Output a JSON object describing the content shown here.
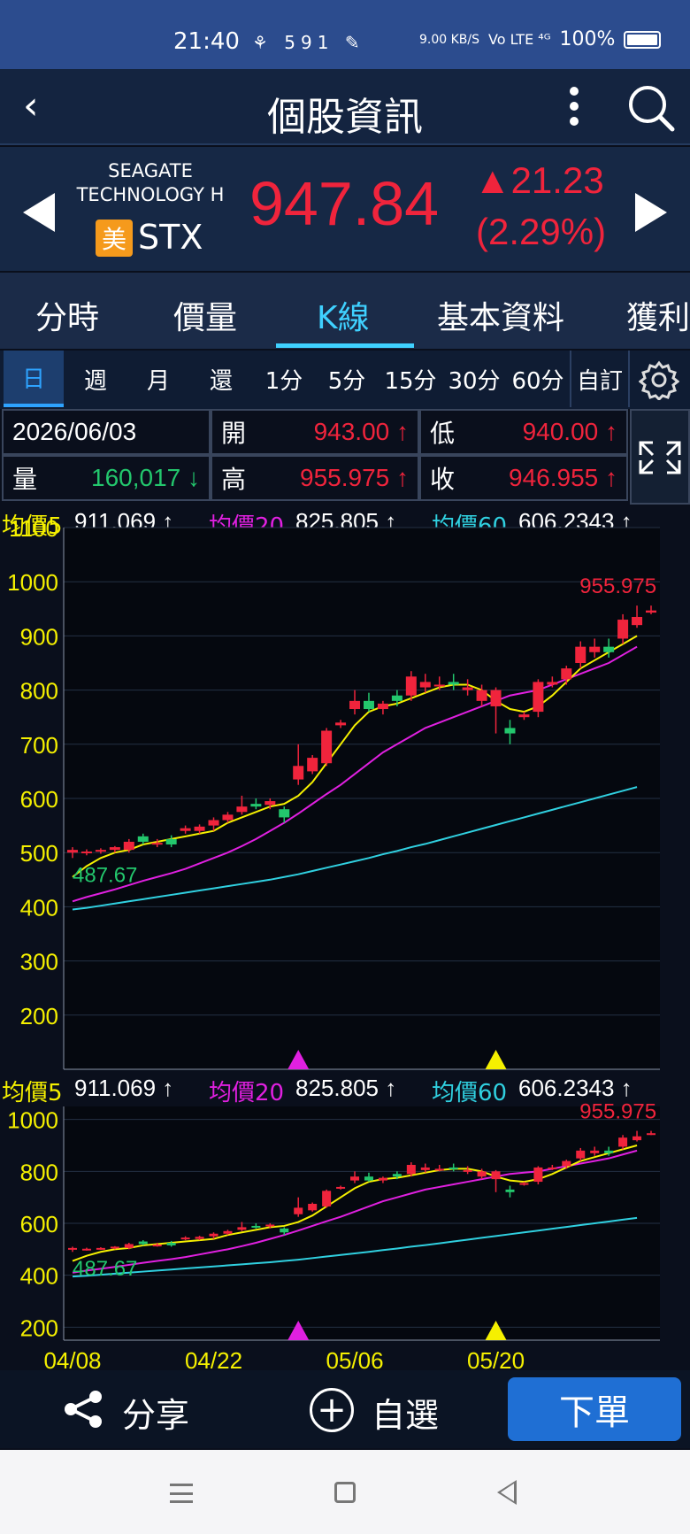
{
  "status_bar": {
    "time": "21:40",
    "icons": "⚘ 591 ✎",
    "net_speed": "9.00 KB/S",
    "signal": "Vo LTE ⁴ᴳ",
    "battery": "100%"
  },
  "header": {
    "title": "個股資訊",
    "back_icon": "chevron-left-icon",
    "more_icon": "more-vertical-icon",
    "search_icon": "search-icon"
  },
  "quote": {
    "name_line1": "SEAGATE",
    "name_line2": "TECHNOLOGY H",
    "market_badge": "美",
    "ticker": "STX",
    "price": "947.84",
    "change": "▲21.23",
    "change_pct": "(2.29%)",
    "up_color": "#f0243c"
  },
  "tabs": [
    "分時",
    "價量",
    "K線",
    "基本資料",
    "獲利"
  ],
  "active_tab": "K線",
  "periods": [
    "日",
    "週",
    "月",
    "還",
    "1分",
    "5分",
    "15分",
    "30分",
    "60分",
    "自訂"
  ],
  "active_period": "日",
  "info": {
    "date": "2026/06/03",
    "open_label": "開",
    "open": "943.00 ↑",
    "low_label": "低",
    "low": "940.00 ↑",
    "volume_label": "量",
    "volume": "160,017 ↓",
    "high_label": "高",
    "high": "955.975 ↑",
    "close_label": "收",
    "close": "946.955 ↑"
  },
  "ma": {
    "ma5_label": "均價5",
    "ma5": "911.069 ↑",
    "ma20_label": "均價20",
    "ma20": "825.805 ↑",
    "ma60_label": "均價60",
    "ma60": "606.2343 ↑"
  },
  "chart_data": {
    "type": "candlestick",
    "y_ticks_main": [
      "1100",
      "1000",
      "900",
      "800",
      "700",
      "600",
      "500",
      "400",
      "300",
      "200"
    ],
    "y_ticks_mini": [
      "1000",
      "800",
      "600",
      "400",
      "200"
    ],
    "x_labels": [
      "04/08",
      "04/22",
      "05/06",
      "05/20"
    ],
    "high_annotation": "955.975",
    "low_annotation": "487.67",
    "ylim_main": [
      100,
      1100
    ],
    "ylim_mini": [
      150,
      1050
    ],
    "candles": [
      [
        500,
        505,
        490,
        510
      ],
      [
        500,
        502,
        495,
        506
      ],
      [
        502,
        505,
        498,
        508
      ],
      [
        505,
        510,
        500,
        512
      ],
      [
        505,
        520,
        500,
        525
      ],
      [
        530,
        520,
        515,
        535
      ],
      [
        515,
        518,
        510,
        525
      ],
      [
        525,
        515,
        510,
        532
      ],
      [
        540,
        545,
        535,
        550
      ],
      [
        540,
        548,
        535,
        552
      ],
      [
        550,
        560,
        540,
        565
      ],
      [
        560,
        570,
        555,
        575
      ],
      [
        575,
        585,
        570,
        605
      ],
      [
        590,
        585,
        580,
        600
      ],
      [
        588,
        595,
        580,
        600
      ],
      [
        580,
        565,
        555,
        585
      ],
      [
        635,
        660,
        625,
        700
      ],
      [
        650,
        675,
        645,
        680
      ],
      [
        665,
        725,
        660,
        730
      ],
      [
        735,
        740,
        730,
        745
      ],
      [
        765,
        780,
        755,
        800
      ],
      [
        780,
        765,
        760,
        795
      ],
      [
        765,
        775,
        755,
        780
      ],
      [
        790,
        780,
        770,
        800
      ],
      [
        790,
        825,
        780,
        835
      ],
      [
        805,
        815,
        795,
        830
      ],
      [
        810,
        810,
        800,
        825
      ],
      [
        815,
        810,
        800,
        830
      ],
      [
        800,
        805,
        790,
        820
      ],
      [
        780,
        800,
        770,
        810
      ],
      [
        770,
        800,
        720,
        805
      ],
      [
        730,
        720,
        700,
        745
      ],
      [
        750,
        755,
        745,
        760
      ],
      [
        760,
        815,
        750,
        820
      ],
      [
        810,
        815,
        805,
        825
      ],
      [
        820,
        840,
        810,
        845
      ],
      [
        850,
        880,
        840,
        890
      ],
      [
        870,
        880,
        860,
        895
      ],
      [
        880,
        870,
        860,
        895
      ],
      [
        895,
        930,
        885,
        940
      ],
      [
        920,
        935,
        915,
        955.975
      ],
      [
        943,
        946.955,
        940,
        955.975
      ]
    ],
    "ma5": [
      455,
      475,
      490,
      500,
      505,
      515,
      520,
      525,
      530,
      535,
      540,
      555,
      565,
      575,
      585,
      590,
      605,
      630,
      665,
      700,
      735,
      760,
      770,
      775,
      785,
      795,
      805,
      810,
      810,
      800,
      780,
      765,
      760,
      770,
      790,
      815,
      840,
      855,
      870,
      885,
      900,
      911.069
    ],
    "ma20": [
      410,
      418,
      425,
      432,
      440,
      448,
      455,
      462,
      470,
      480,
      490,
      500,
      512,
      525,
      540,
      555,
      572,
      590,
      608,
      625,
      645,
      665,
      685,
      700,
      715,
      730,
      740,
      750,
      760,
      770,
      780,
      790,
      795,
      800,
      810,
      820,
      830,
      840,
      850,
      865,
      880,
      825.805
    ],
    "ma60": [
      395,
      398,
      402,
      406,
      410,
      414,
      418,
      422,
      426,
      430,
      434,
      438,
      442,
      446,
      450,
      455,
      460,
      466,
      472,
      478,
      484,
      490,
      497,
      503,
      510,
      516,
      523,
      530,
      537,
      544,
      551,
      558,
      565,
      572,
      579,
      586,
      593,
      600,
      607,
      614,
      621,
      606.2343
    ],
    "markers": [
      {
        "index": 16,
        "color": "#e020e0"
      },
      {
        "index": 30,
        "color": "#f5f000"
      }
    ],
    "colors": {
      "up": "#f0243c",
      "down": "#23c76d",
      "ma5": "#f5f000",
      "ma20": "#e020e0",
      "ma60": "#30d0e0",
      "axis": "#f5f000"
    }
  },
  "bottom_bar": {
    "share": "分享",
    "add": "自選",
    "order": "下單"
  }
}
